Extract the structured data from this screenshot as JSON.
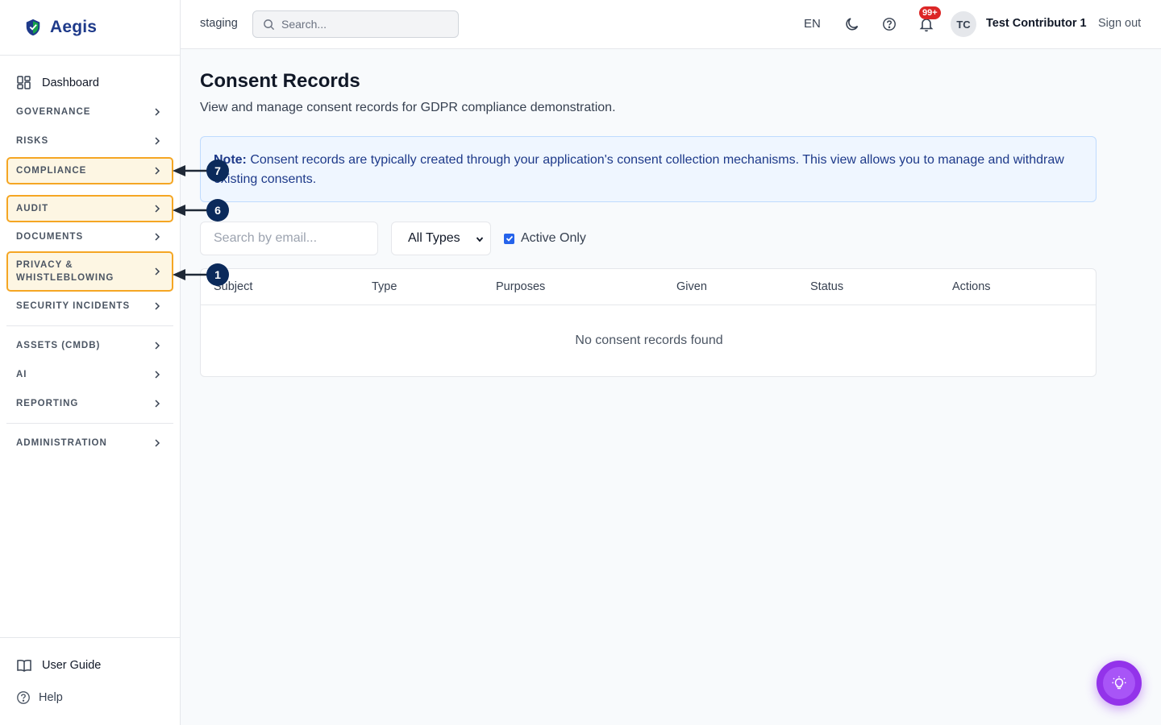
{
  "brand": {
    "name": "Aegis"
  },
  "sidebar": {
    "dashboard": "Dashboard",
    "sections": [
      "GOVERNANCE",
      "RISKS",
      "COMPLIANCE",
      "AUDIT",
      "DOCUMENTS",
      "PRIVACY & WHISTLEBLOWING",
      "SECURITY INCIDENTS",
      "ASSETS (CMDB)",
      "AI",
      "REPORTING",
      "ADMINISTRATION"
    ],
    "footer": {
      "user_guide": "User Guide",
      "help": "Help"
    }
  },
  "header": {
    "environment": "staging",
    "search_placeholder": "Search...",
    "language": "EN",
    "notifications_badge": "99+",
    "avatar_initials": "TC",
    "user_name": "Test Contributor 1",
    "sign_out": "Sign out"
  },
  "page": {
    "title": "Consent Records",
    "subtitle": "View and manage consent records for GDPR compliance demonstration.",
    "note_label": "Note:",
    "note_text": " Consent records are typically created through your application's consent collection mechanisms. This view allows you to manage and withdraw existing consents."
  },
  "filters": {
    "email_placeholder": "Search by email...",
    "type_selected": "All Types",
    "active_only_label": "Active Only",
    "active_only_checked": true
  },
  "table": {
    "columns": [
      "Subject",
      "Type",
      "Purposes",
      "Given",
      "Status",
      "Actions"
    ],
    "empty_message": "No consent records found"
  },
  "callouts": [
    "7",
    "6",
    "1"
  ],
  "colors": {
    "highlight_border": "#f5a623",
    "callout": "#0b2a5b",
    "brand": "#1e3a8a",
    "fab": "#9333ea"
  }
}
